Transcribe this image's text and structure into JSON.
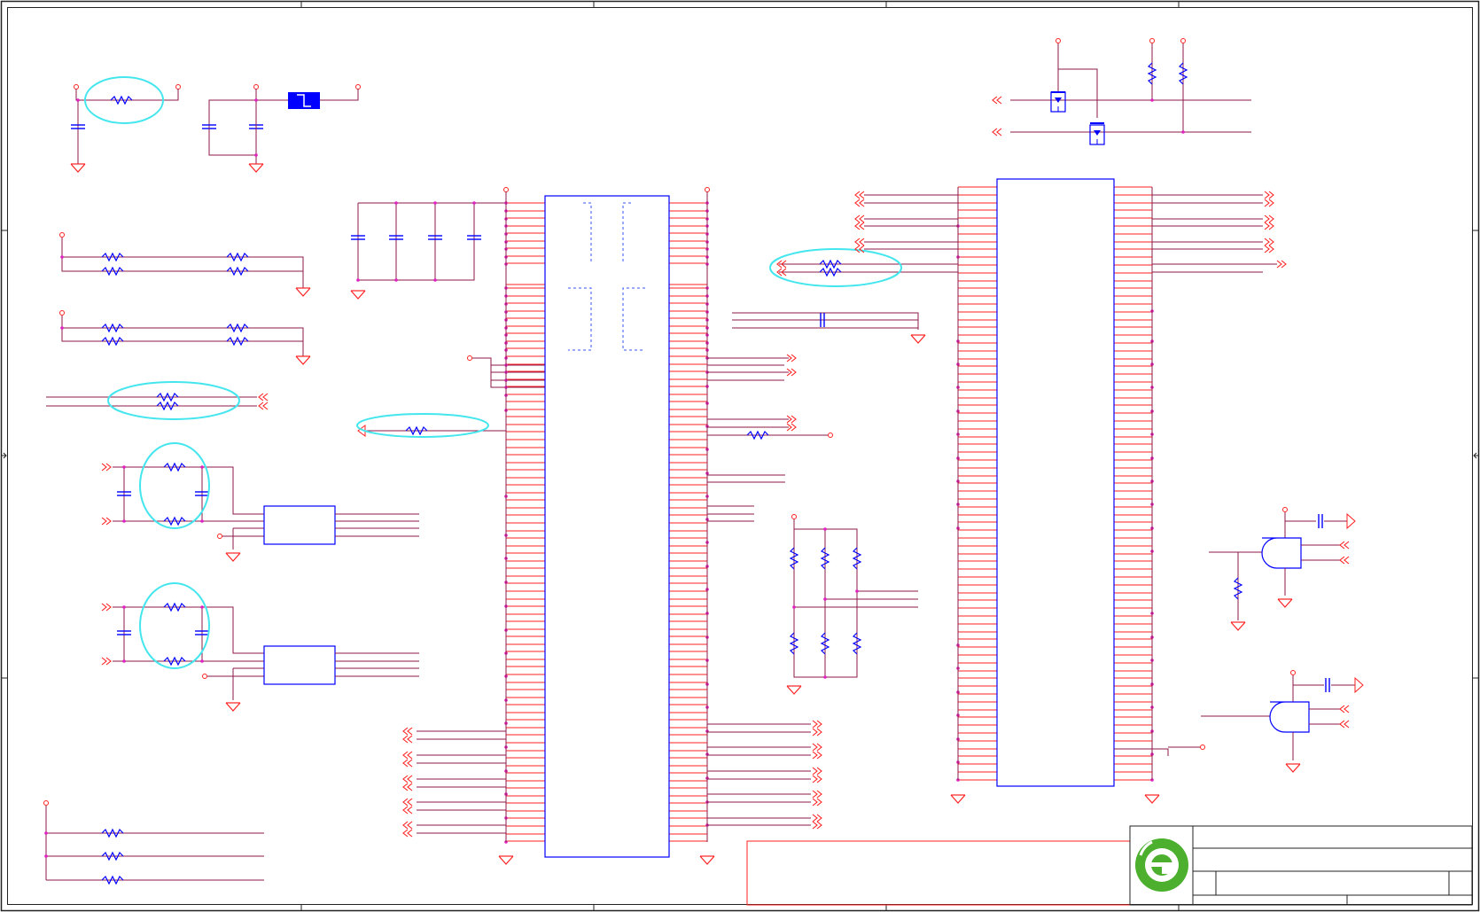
{
  "sheet": {
    "colors": {
      "background": "#ffffff",
      "frame": "#222222",
      "wire": "#8b1a4a",
      "pin": "#ff2020",
      "component": "#0000ff",
      "dashed": "#3355ff",
      "highlight": "#44e6ee",
      "node": "#e020c0",
      "logo_green": "#4caf2e",
      "logo_blank": "#ffffff"
    },
    "icons": {
      "logo": "circled-e-logo",
      "ground": "ground-symbol",
      "resistor": "zigzag-resistor",
      "capacitor": "capacitor-plates",
      "offpage": "double-chevron-connector",
      "gate": "and-gate",
      "mosfet": "mosfet-symbol",
      "crystal": "crystal-block"
    }
  }
}
